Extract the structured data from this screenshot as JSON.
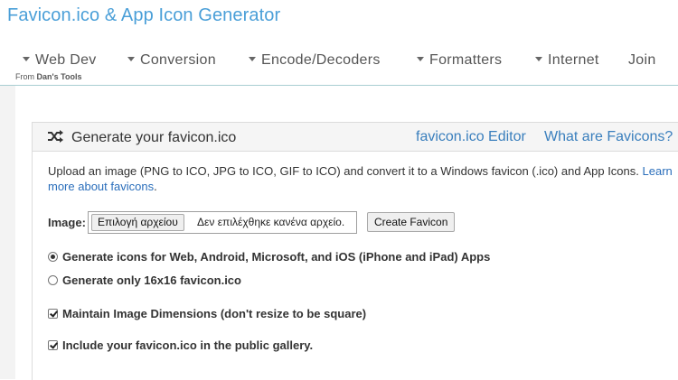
{
  "site": {
    "title": "Favicon.ico & App Icon Generator",
    "from_prefix": "From ",
    "from_brand": "Dan's Tools"
  },
  "nav": {
    "items": [
      {
        "label": "Web Dev",
        "caret": true
      },
      {
        "label": "Conversion",
        "caret": true
      },
      {
        "label": "Encode/Decoders",
        "caret": true
      },
      {
        "label": "Formatters",
        "caret": true
      },
      {
        "label": "Internet",
        "caret": true
      },
      {
        "label": "Join",
        "caret": false
      }
    ]
  },
  "panel": {
    "title": "Generate your favicon.ico",
    "icon": "shuffle-icon",
    "links": {
      "editor": "favicon.ico Editor",
      "what": "What are Favicons?"
    },
    "description": "Upload an image (PNG to ICO, JPG to ICO, GIF to ICO) and convert it to a Windows favicon (.ico) and App Icons.",
    "learn_more": "Learn more about favicons",
    "image_label": "Image:",
    "file_button": "Επιλογή αρχείου",
    "file_status": "Δεν επιλέχθηκε κανένα αρχείο.",
    "create_button": "Create Favicon",
    "options": {
      "radio_all": "Generate icons for Web, Android, Microsoft, and iOS (iPhone and iPad) Apps",
      "radio_16": "Generate only 16x16 favicon.ico",
      "maintain": "Maintain Image Dimensions (don't resize to be square)",
      "gallery": "Include your favicon.ico in the public gallery."
    }
  },
  "colors": {
    "link": "#3a7fbd",
    "title": "#4a9fd8",
    "rule": "#a8ced2"
  }
}
